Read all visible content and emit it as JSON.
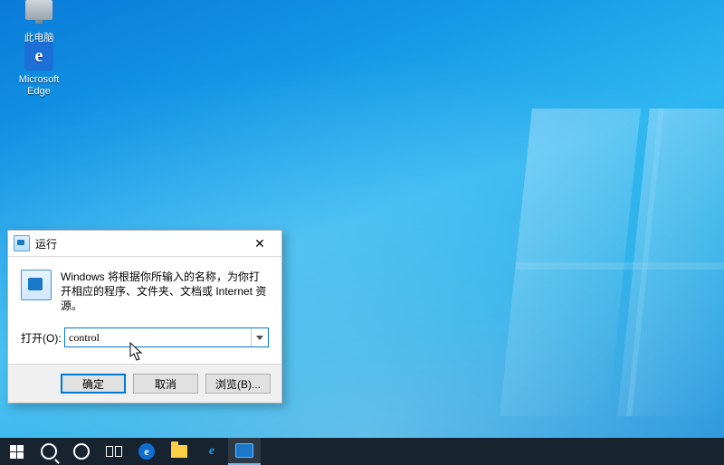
{
  "desktop": {
    "icons": {
      "this_pc": "此电脑",
      "edge": "Microsoft\nEdge"
    }
  },
  "run_dialog": {
    "title": "运行",
    "description": "Windows 将根据你所输入的名称，为你打开相应的程序、文件夹、文档或 Internet 资源。",
    "open_label": "打开(O):",
    "open_value": "control",
    "ok": "确定",
    "cancel": "取消",
    "browse": "浏览(B)..."
  }
}
